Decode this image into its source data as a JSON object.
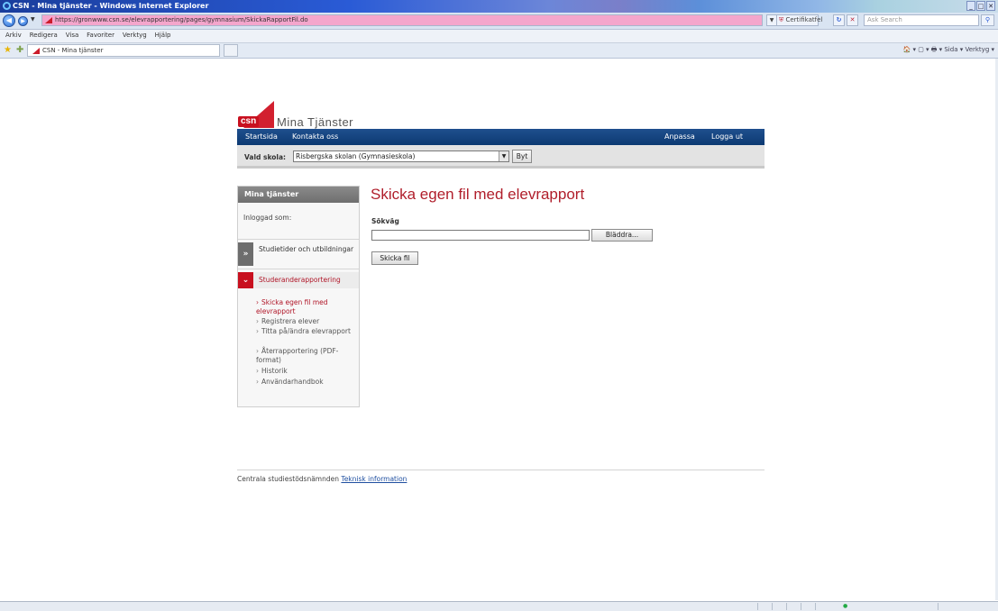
{
  "browser": {
    "window_title": "CSN - Mina tjänster - Windows Internet Explorer",
    "url": "https://gronwww.csn.se/elevrapportering/pages/gymnasium/SkickaRapportFil.do",
    "cert_error": "Certifikatfel",
    "search_placeholder": "Ask Search",
    "menu": [
      "Arkiv",
      "Redigera",
      "Visa",
      "Favoriter",
      "Verktyg",
      "Hjälp"
    ],
    "tab_label": "CSN - Mina tjänster",
    "command_bar": "🏠 ▾  ▢ ▾  🖶 ▾  Sida ▾  Verktyg ▾",
    "window_buttons": [
      "_",
      "□",
      "✕"
    ]
  },
  "site": {
    "brand_logo": "csn",
    "brand_name": "Mina Tjänster",
    "nav_left": [
      "Startsida",
      "Kontakta oss"
    ],
    "nav_right": [
      "Anpassa",
      "Logga ut"
    ],
    "school_label": "Vald skola:",
    "school_selected": "Risbergska skolan (Gymnasieskola)",
    "switch_button": "Byt"
  },
  "sidebar": {
    "title": "Mina tjänster",
    "logged_in_label": "Inloggad som:",
    "section1": {
      "label": "Studietider och utbildningar",
      "icon": "double-chevron-right-icon"
    },
    "section2": {
      "label": "Studeranderapportering",
      "icon": "double-chevron-down-icon"
    },
    "items": [
      "Skicka egen fil med elevrapport",
      "Registrera elever",
      "Titta på/ändra elevrapport",
      "Återrapportering (PDF-format)",
      "Historik",
      "Användarhandbok"
    ],
    "active_index": 0
  },
  "main": {
    "heading": "Skicka egen fil med elevrapport",
    "path_label": "Sökväg",
    "browse_button": "Bläddra...",
    "send_button": "Skicka fil"
  },
  "footer": {
    "org": "Centrala studiestödsnämnden",
    "link": "Teknisk information"
  },
  "colors": {
    "nav_blue": "#0c3a72",
    "csn_red": "#c8101f",
    "heading_red": "#b01e2b",
    "link_blue": "#1f4fa0"
  }
}
